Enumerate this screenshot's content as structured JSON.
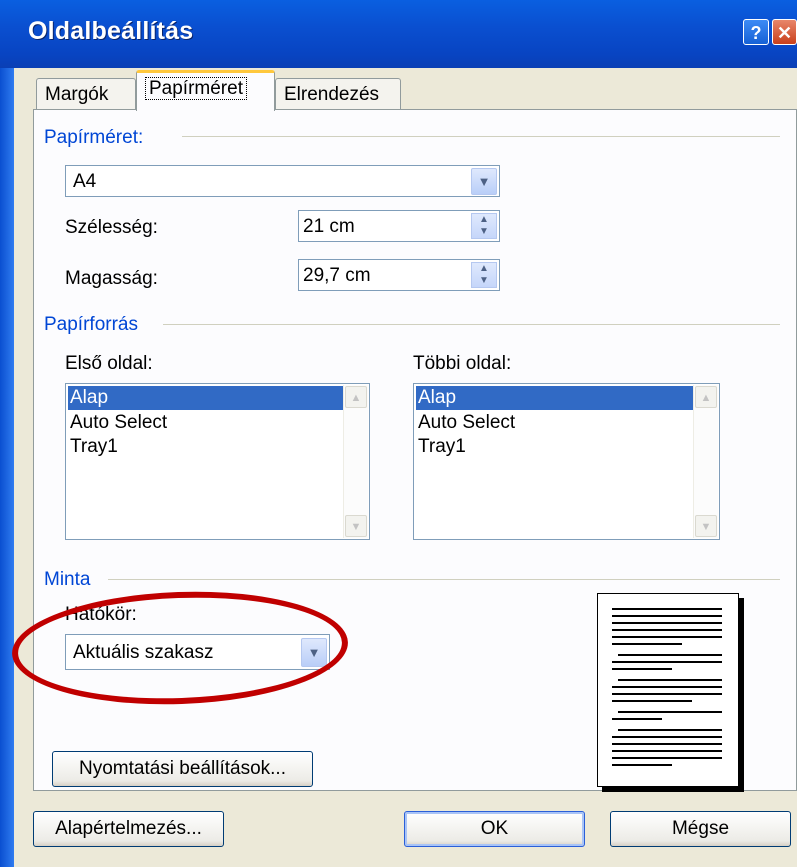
{
  "dialog": {
    "title": "Oldalbeállítás",
    "help_glyph": "?",
    "close_glyph": "✕"
  },
  "tabs": [
    {
      "label": "Margók",
      "active": false
    },
    {
      "label": "Papírméret",
      "active": true
    },
    {
      "label": "Elrendezés",
      "active": false
    }
  ],
  "paper_size": {
    "group_label": "Papírméret:",
    "selected": "A4",
    "width_label": "Szélesség:",
    "width_value": "21 cm",
    "height_label": "Magasság:",
    "height_value": "29,7 cm"
  },
  "paper_source": {
    "group_label": "Papírforrás",
    "first_page_label": "Első oldal:",
    "other_pages_label": "Többi oldal:",
    "first_page_items": [
      "Alap",
      "Auto Select",
      "Tray1"
    ],
    "other_pages_items": [
      "Alap",
      "Auto Select",
      "Tray1"
    ],
    "selected_index": 0
  },
  "preview": {
    "group_label": "Minta",
    "apply_to_label": "Hatókör:",
    "apply_to_value": "Aktuális szakasz"
  },
  "buttons": {
    "print_options": "Nyomtatási beállítások...",
    "default": "Alapértelmezés...",
    "ok": "OK",
    "cancel": "Mégse"
  },
  "icons": {
    "dropdown": "chevron-down-icon",
    "spin": "spin-arrows-icon",
    "scroll_up": "scroll-up-icon",
    "scroll_down": "scroll-down-icon"
  },
  "colors": {
    "titlebar": "#0a4fd0",
    "group_label": "#0046d5",
    "selection": "#316ac5",
    "annotation": "#c00000",
    "tab_highlight": "#ffc83c"
  }
}
